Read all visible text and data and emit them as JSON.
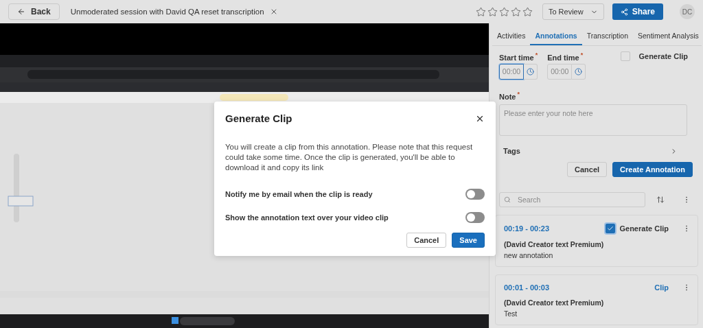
{
  "header": {
    "back": "Back",
    "title": "Unmoderated session with David QA reset transcription",
    "stars": 0,
    "status": "To Review",
    "share": "Share",
    "avatar": "DC"
  },
  "modal": {
    "title": "Generate Clip",
    "body": "You will create a clip from this annotation. Please note that this request could take some time. Once the clip is generated, you'll be able to download it and copy its link",
    "options": [
      {
        "label": "Notify me by email when the clip is ready",
        "on": false
      },
      {
        "label": "Show the annotation text over your video clip",
        "on": false
      }
    ],
    "buttons": [
      {
        "label": "Cancel",
        "kind": "secondary"
      },
      {
        "label": "Save",
        "kind": "primary"
      }
    ]
  },
  "panel": {
    "tabs": [
      {
        "label": "Activities",
        "selected": false
      },
      {
        "label": "Annotations",
        "selected": true
      },
      {
        "label": "Transcription",
        "selected": false
      },
      {
        "label": "Sentiment Analysis",
        "selected": false
      }
    ],
    "form": {
      "start": {
        "label": "Start time",
        "mark": "*",
        "placeholder": "00:00",
        "focused": true
      },
      "end": {
        "label": "End time",
        "mark": "*",
        "placeholder": "00:00",
        "focused": false
      },
      "clip": {
        "label": "Generate Clip",
        "checked": false
      },
      "note": {
        "label": "Note",
        "mark": "*",
        "placeholder": "Please enter your note here"
      },
      "tags": "Tags",
      "buttons": [
        {
          "label": "Cancel",
          "kind": "secondary"
        },
        {
          "label": "Create Annotation",
          "kind": "primary"
        }
      ]
    },
    "search": {
      "placeholder": "Search"
    },
    "annotations": [
      {
        "time": "00:19 - 00:23",
        "clip": {
          "kind": "checkbox",
          "label": "Generate Clip",
          "checked": true
        },
        "author": "(David Creator text Premium)",
        "text": "new annotation"
      },
      {
        "time": "00:01 - 00:03",
        "clip": {
          "kind": "link",
          "label": "Clip"
        },
        "author": "(David Creator text Premium)",
        "text": "Test"
      }
    ]
  }
}
